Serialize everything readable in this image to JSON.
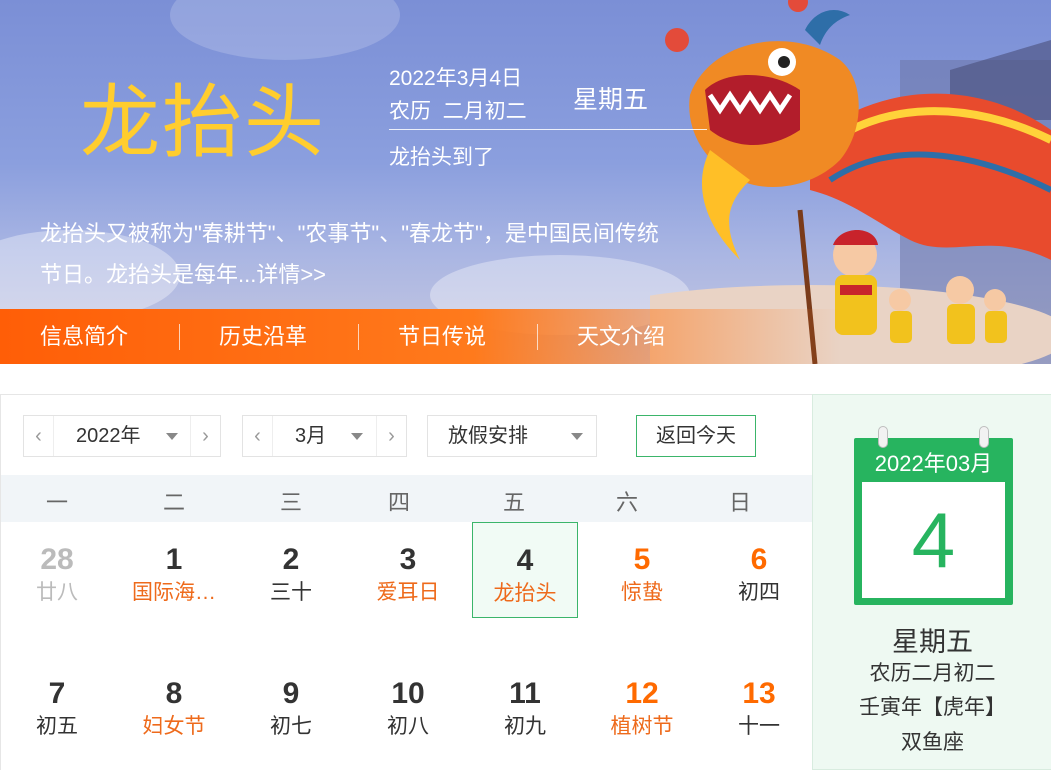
{
  "banner": {
    "title": "龙抬头",
    "date": "2022年3月4日",
    "lunar": "农历  二月初二",
    "weekday": "星期五",
    "arrived": "龙抬头到了",
    "intro": "龙抬头又被称为\"春耕节\"、\"农事节\"、\"春龙节\"，是中国民间传统节日。龙抬头是每年...详情>>",
    "tabs": [
      "信息简介",
      "历史沿革",
      "节日传说",
      "天文介绍"
    ]
  },
  "controls": {
    "year": "2022年",
    "month": "3月",
    "holiday": "放假安排",
    "today_button": "返回今天"
  },
  "weekdays": [
    "一",
    "二",
    "三",
    "四",
    "五",
    "六",
    "日"
  ],
  "days": [
    {
      "num": "28",
      "sub": "廿八",
      "other": true
    },
    {
      "num": "1",
      "sub": "国际海…",
      "fest": true
    },
    {
      "num": "2",
      "sub": "三十"
    },
    {
      "num": "3",
      "sub": "爱耳日",
      "fest": true
    },
    {
      "num": "4",
      "sub": "龙抬头",
      "fest": true,
      "selected": true
    },
    {
      "num": "5",
      "sub": "惊蛰",
      "fest": true,
      "weekend": true
    },
    {
      "num": "6",
      "sub": "初四",
      "weekend": true
    },
    {
      "num": "7",
      "sub": "初五"
    },
    {
      "num": "8",
      "sub": "妇女节",
      "fest": true
    },
    {
      "num": "9",
      "sub": "初七"
    },
    {
      "num": "10",
      "sub": "初八"
    },
    {
      "num": "11",
      "sub": "初九"
    },
    {
      "num": "12",
      "sub": "植树节",
      "fest": true,
      "weekend": true
    },
    {
      "num": "13",
      "sub": "十一",
      "weekend": true
    }
  ],
  "side": {
    "year_month": "2022年03月",
    "day": "4",
    "weekday": "星期五",
    "lunar": "农历二月初二",
    "ganzhi": "壬寅年【虎年】",
    "zodiac": "双鱼座"
  },
  "colors": {
    "accent_green": "#27b45f",
    "festival_orange": "#ee6a1b",
    "title_yellow": "#ffcd2e",
    "tab_orange": "#ff5e07"
  },
  "icons": {
    "prev": "chevron-left-icon",
    "next": "chevron-right-icon",
    "dropdown": "caret-down-icon"
  }
}
